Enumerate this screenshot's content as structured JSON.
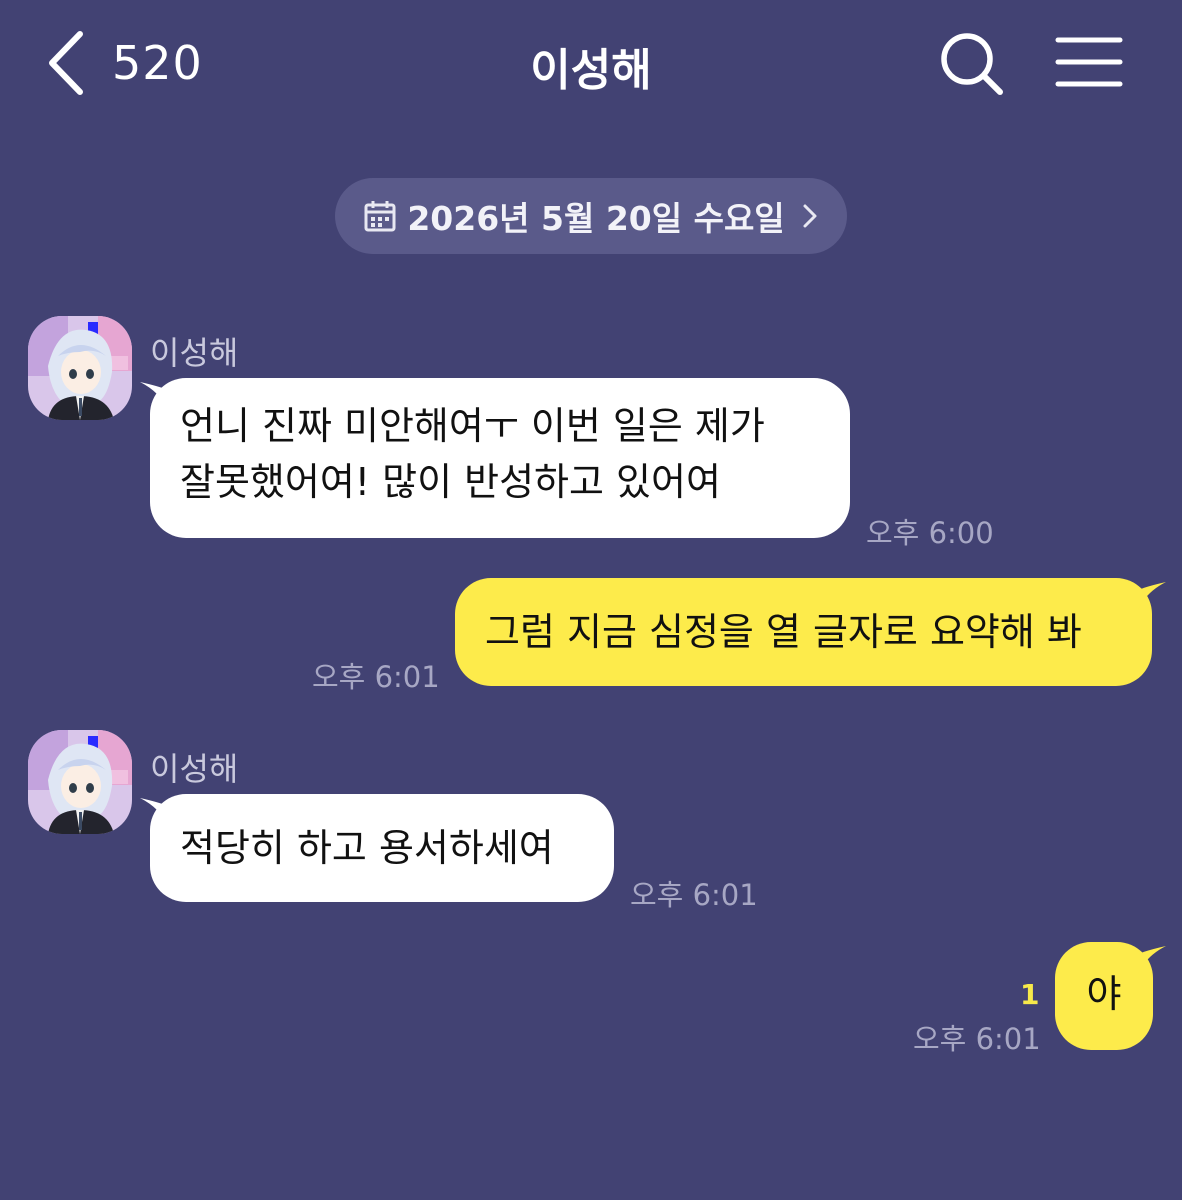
{
  "header": {
    "back_count": "520",
    "title": "이성해"
  },
  "date_divider": {
    "text": "2026년 5월 20일 수요일"
  },
  "messages": [
    {
      "sender": "이성해",
      "line1": "언니 진짜 미안해여ㅜ 이번 일은 제가",
      "line2": "잘못했어여! 많이 반성하고 있어여",
      "time": "오후 6:00"
    },
    {
      "text": "그럼 지금 심정을 열 글자로 요약해 봐",
      "time": "오후 6:01"
    },
    {
      "sender": "이성해",
      "text": "적당히 하고 용서하세여",
      "time": "오후 6:01"
    },
    {
      "text": "야",
      "unread": "1",
      "time": "오후 6:01"
    }
  ],
  "colors": {
    "background": "#424273",
    "incoming_bubble": "#ffffff",
    "outgoing_bubble": "#fdeb4b",
    "unread_count": "#f7e94a"
  },
  "icons": {
    "back": "chevron-left-icon",
    "search": "search-icon",
    "menu": "hamburger-menu-icon",
    "calendar": "calendar-icon",
    "date_chevron": "chevron-right-icon"
  }
}
